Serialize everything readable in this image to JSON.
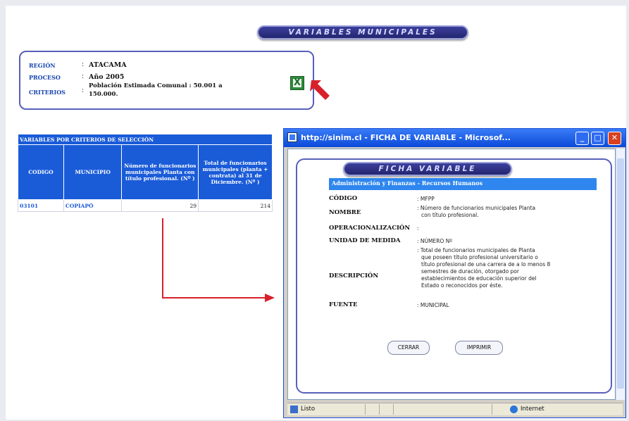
{
  "header": {
    "title": "VARIABLES MUNICIPALES"
  },
  "criteria": {
    "region_label": "REGIÓN",
    "region_value": "ATACAMA",
    "proceso_label": "PROCESO",
    "proceso_value": "Año 2005",
    "criterios_label": "CRITERIOS",
    "criterios_value_line1": "Población Estimada Comunal : 50.001 a",
    "criterios_value_line2": "150.000.",
    "separator": ":"
  },
  "icons": {
    "excel": "excel-icon",
    "arrow": "red-arrow-icon"
  },
  "table": {
    "caption": "VARIABLES POR CRITERIOS DE SELECCIÓN",
    "headers": [
      "CODIGO",
      "MUNICIPIO",
      "Número de funcionarios municipales Planta con título profesional. (Nº )",
      "Total de funcionarios municipales (planta + contrata) al 31 de Diciembre. (Nº )"
    ],
    "rows": [
      {
        "codigo": "03101",
        "municipio": "COPIAPÓ",
        "num_planta": "29",
        "total": "214"
      }
    ]
  },
  "popup": {
    "title": "http://sinim.cl - FICHA DE VARIABLE - Microsof...",
    "heading": "FICHA VARIABLE",
    "category": "Administración y Finanzas - Recursos Humanos",
    "fields": {
      "codigo_label": "CÓDIGO",
      "codigo_value": ": MFPP",
      "nombre_label": "NOMBRE",
      "nombre_value_1": ": Número de funcionarios municipales Planta",
      "nombre_value_2": "con título profesional.",
      "operacionalizacion_label": "OPERACIONALIZACIÓN",
      "operacionalizacion_value": ":",
      "unidad_label": "UNIDAD DE MEDIDA",
      "unidad_value": ": NÚMERO Nº",
      "descripcion_label": "DESCRIPCIÓN",
      "descripcion_lines": [
        ": Total de funcionarios municipales de Planta",
        "que poseen título profesional universitario o",
        "título profesional de una carrera de a lo menos 8",
        "semestres de duración, otorgado por",
        "establecimientos de educación superior del",
        "Estado o reconocidos por éste."
      ],
      "fuente_label": "FUENTE",
      "fuente_value": ": MUNICIPAL"
    },
    "buttons": {
      "cerrar": "CERRAR",
      "imprimir": "IMPRIMIR"
    },
    "status_left": "Listo",
    "status_right": "Internet"
  },
  "colors": {
    "accent": "#1a5bd8",
    "pill": "#2a2d7a",
    "arrow": "#d8202a"
  }
}
